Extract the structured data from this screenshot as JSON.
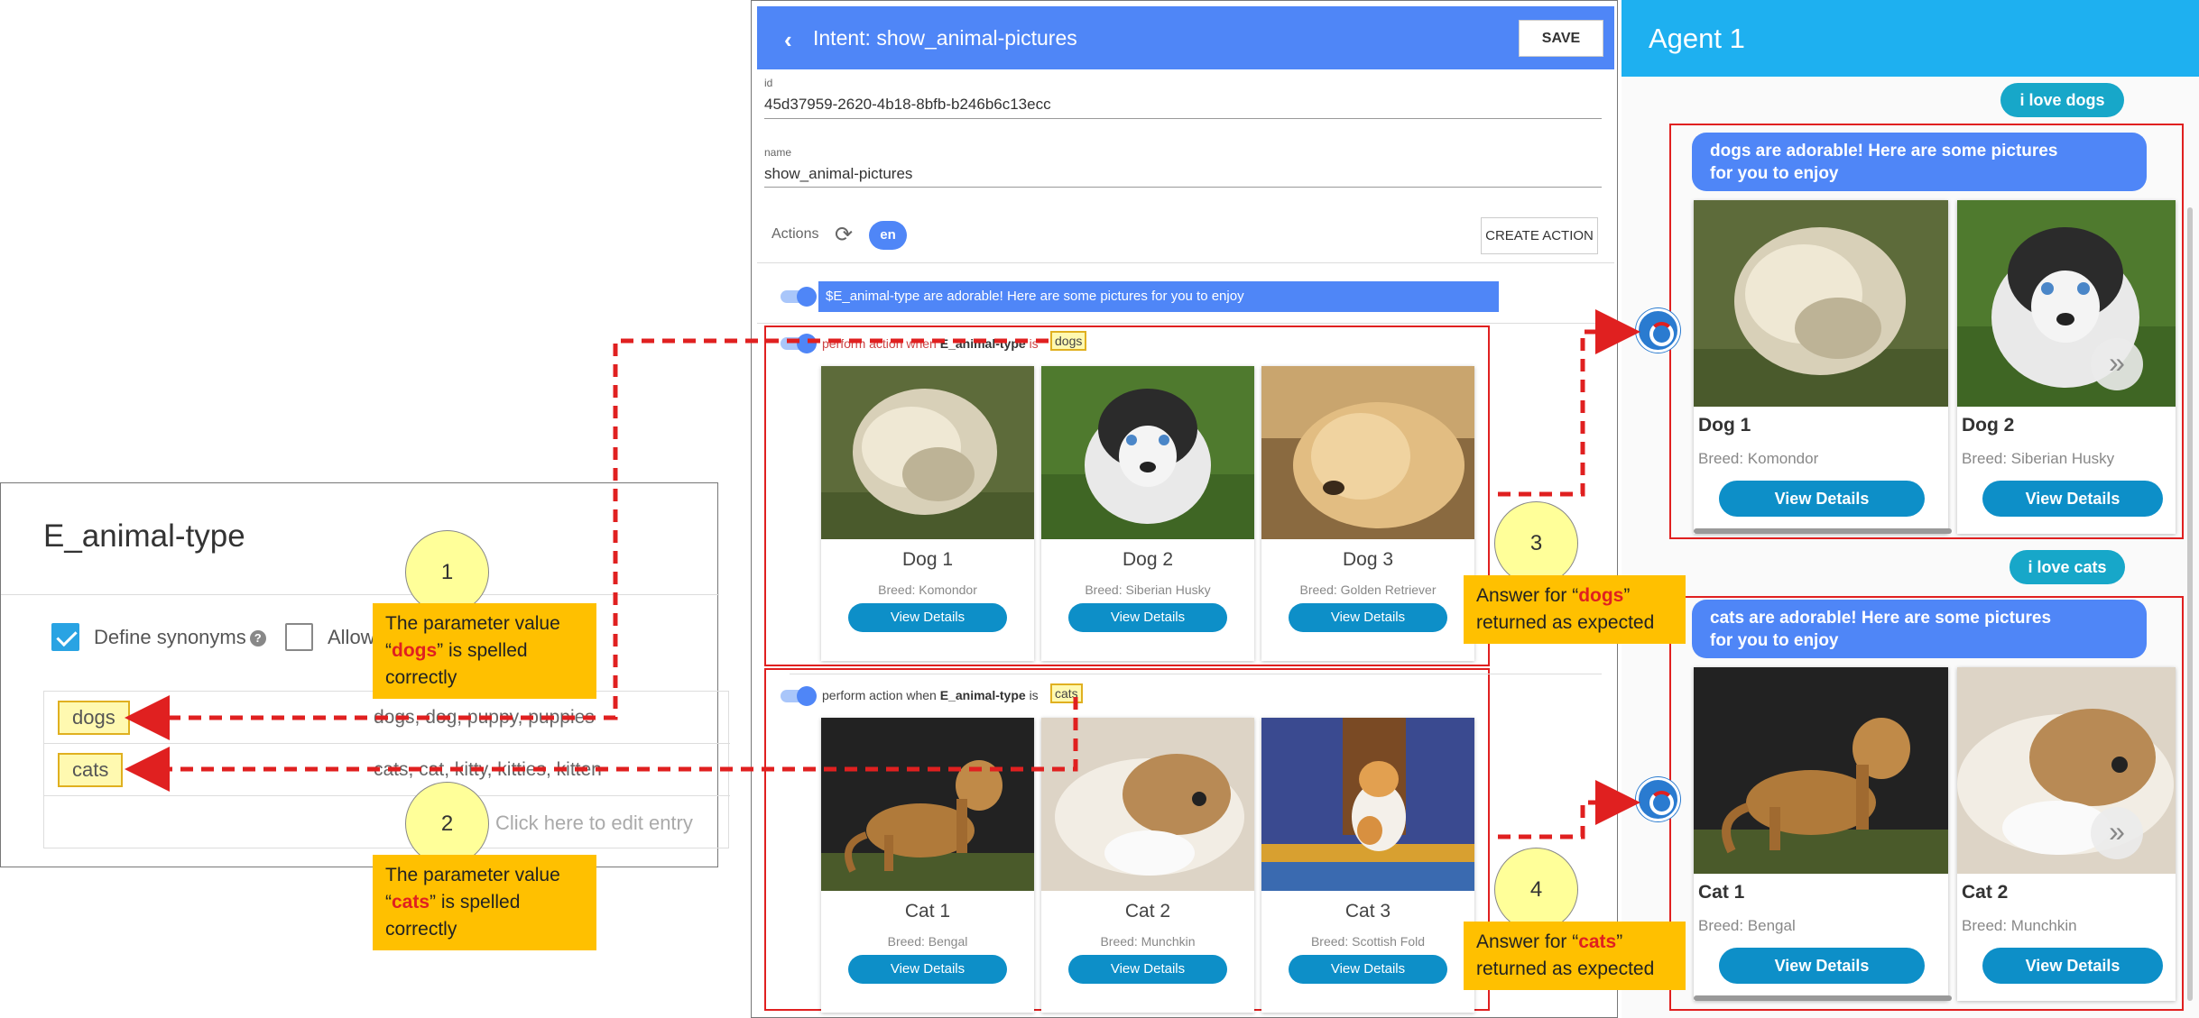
{
  "entity": {
    "title": "E_animal-type",
    "define_synonyms_label": "Define synonyms",
    "allow_label": "Allow",
    "rows": [
      {
        "value": "dogs",
        "synonyms": "dogs, dog, puppy, puppies"
      },
      {
        "value": "cats",
        "synonyms": "cats, cat, kitty, kitties, kitten"
      }
    ],
    "placeholder": "Click here to edit entry"
  },
  "intent": {
    "header_title": "Intent: show_animal-pictures",
    "save_label": "SAVE",
    "id_label": "id",
    "id_value": "45d37959-2620-4b18-8bfb-b246b6c13ecc",
    "name_label": "name",
    "name_value": "show_animal-pictures",
    "actions_label": "Actions",
    "lang": "en",
    "create_action_label": "CREATE ACTION",
    "response_text": "$E_animal-type are adorable! Here are some pictures for you to enjoy",
    "condition_prefix": "perform action when",
    "condition_entity": "E_animal-type",
    "condition_is": "is",
    "dogs_value": "dogs",
    "cats_value": "cats",
    "dog_cards": [
      {
        "title": "Dog 1",
        "breed": "Breed: Komondor",
        "button": "View Details"
      },
      {
        "title": "Dog 2",
        "breed": "Breed: Siberian Husky",
        "button": "View Details"
      },
      {
        "title": "Dog 3",
        "breed": "Breed: Golden Retriever",
        "button": "View Details"
      }
    ],
    "cat_cards": [
      {
        "title": "Cat 1",
        "breed": "Breed: Bengal",
        "button": "View Details"
      },
      {
        "title": "Cat 2",
        "breed": "Breed: Munchkin",
        "button": "View Details"
      },
      {
        "title": "Cat 3",
        "breed": "Breed: Scottish Fold",
        "button": "View Details"
      }
    ]
  },
  "agent": {
    "title": "Agent 1",
    "user_msg_1": "i love dogs",
    "bot_msg_1_line1": "dogs are adorable! Here are some pictures",
    "bot_msg_1_line2": "for you to enjoy",
    "user_msg_2": "i love cats",
    "bot_msg_2_line1": "cats are adorable! Here are some pictures",
    "bot_msg_2_line2": "for you to enjoy",
    "dog_cards": [
      {
        "title": "Dog 1",
        "breed": "Breed: Komondor",
        "button": "View Details"
      },
      {
        "title": "Dog 2",
        "breed": "Breed: Siberian Husky",
        "button": "View Details"
      }
    ],
    "cat_cards": [
      {
        "title": "Cat 1",
        "breed": "Breed: Bengal",
        "button": "View Details"
      },
      {
        "title": "Cat 2",
        "breed": "Breed: Munchkin",
        "button": "View Details"
      }
    ],
    "next_glyph": "»"
  },
  "callouts": {
    "n1": "1",
    "n2": "2",
    "n3": "3",
    "n4": "4",
    "note1_pre": "The parameter value",
    "note1_open": "“",
    "note1_val": "dogs",
    "note1_close": "” is spelled",
    "note1_end": "correctly",
    "note2_pre": "The parameter value",
    "note2_open": "“",
    "note2_val": "cats",
    "note2_close": "” is spelled",
    "note2_end": "correctly",
    "note3_pre": "Answer for “",
    "note3_val": "dogs",
    "note3_close": "”",
    "note3_end": "returned as expected",
    "note4_pre": "Answer for “",
    "note4_val": "cats",
    "note4_close": "”",
    "note4_end": "returned as expected"
  },
  "colors": {
    "intent_header": "#4f86f7",
    "agent_header": "#1eb0f0",
    "button": "#0d8fc8",
    "callout_box": "#ffc000",
    "callout_circle": "#ffff99",
    "annotation_red": "#e02020"
  },
  "icons": {
    "back": "chevron-left-icon",
    "refresh": "refresh-icon",
    "help": "help-circle-icon",
    "agent_avatar": "agent-avatar-icon",
    "next": "chevron-double-right-icon"
  }
}
